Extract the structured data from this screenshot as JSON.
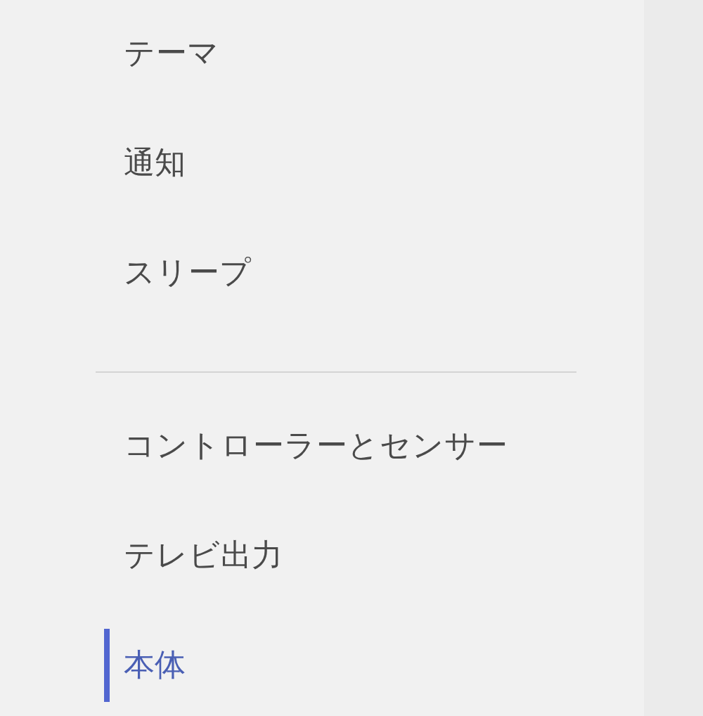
{
  "groups": [
    {
      "items": [
        {
          "label": "テーマ",
          "selected": false
        },
        {
          "label": "通知",
          "selected": false
        },
        {
          "label": "スリープ",
          "selected": false
        }
      ]
    },
    {
      "items": [
        {
          "label": "コントローラーとセンサー",
          "selected": false
        },
        {
          "label": "テレビ出力",
          "selected": false
        },
        {
          "label": "本体",
          "selected": true
        }
      ]
    }
  ]
}
